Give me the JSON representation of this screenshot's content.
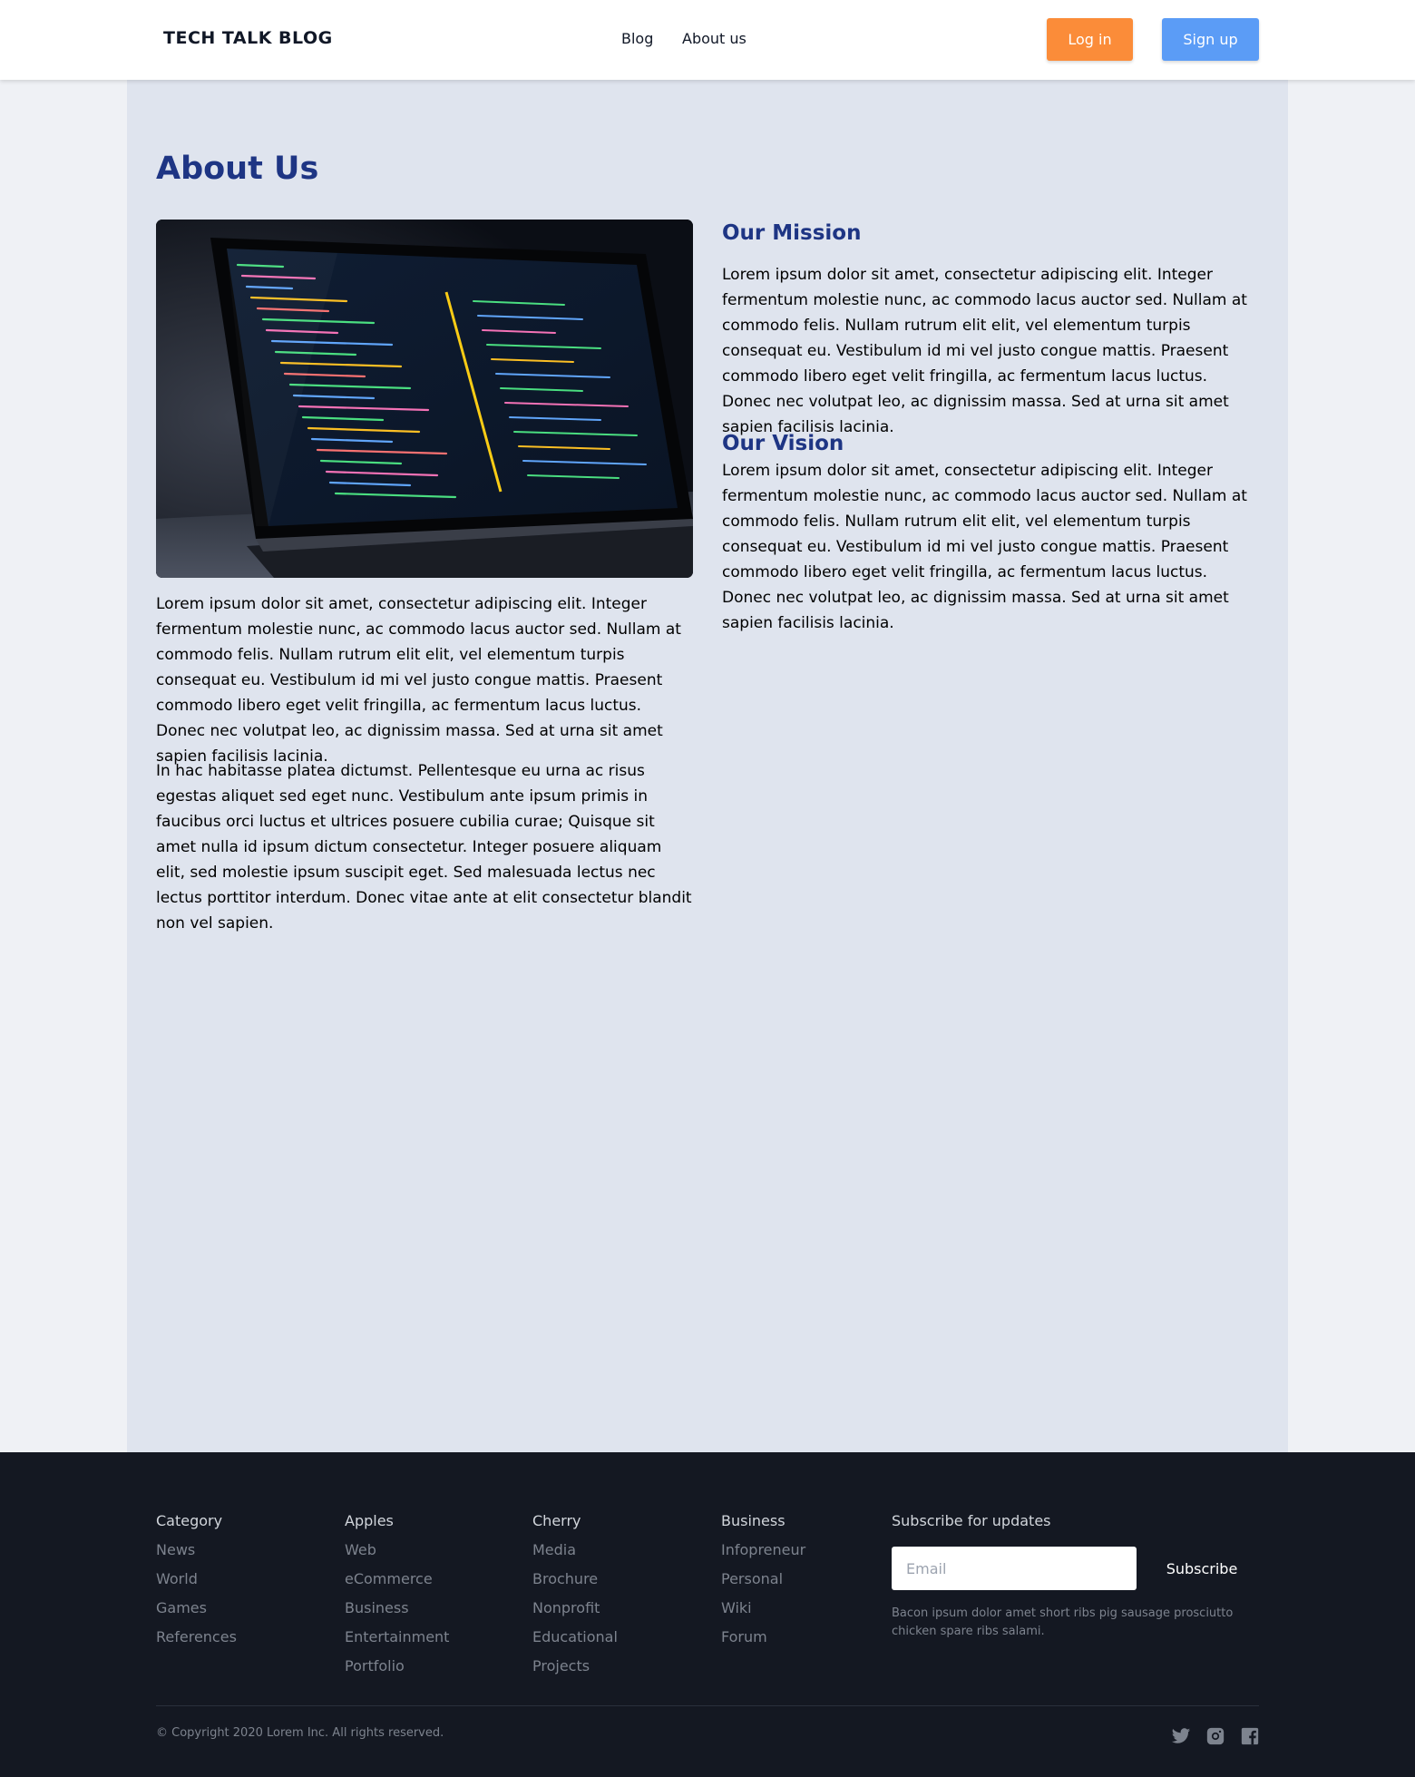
{
  "header": {
    "brand": "TECH TALK BLOG",
    "nav": {
      "blog": "Blog",
      "about": "About us"
    },
    "login_label": "Log in",
    "signup_label": "Sign up",
    "colors": {
      "login": "#fb8c39",
      "signup": "#5b9cf6"
    }
  },
  "main": {
    "title": "About Us",
    "image_icon": "laptop-code-photo",
    "left_paragraphs": [
      "Lorem ipsum dolor sit amet, consectetur adipiscing elit. Integer fermentum molestie nunc, ac commodo lacus auctor sed. Nullam at commodo felis. Nullam rutrum elit elit, vel elementum turpis consequat eu. Vestibulum id mi vel justo congue mattis. Praesent commodo libero eget velit fringilla, ac fermentum lacus luctus. Donec nec volutpat leo, ac dignissim massa. Sed at urna sit amet sapien facilisis lacinia.",
      "In hac habitasse platea dictumst. Pellentesque eu urna ac risus egestas aliquet sed eget nunc. Vestibulum ante ipsum primis in faucibus orci luctus et ultrices posuere cubilia curae; Quisque sit amet nulla id ipsum dictum consectetur. Integer posuere aliquam elit, sed molestie ipsum suscipit eget. Sed malesuada lectus nec lectus porttitor interdum. Donec vitae ante at elit consectetur blandit non vel sapien."
    ],
    "mission": {
      "title": "Our Mission",
      "text": "Lorem ipsum dolor sit amet, consectetur adipiscing elit. Integer fermentum molestie nunc, ac commodo lacus auctor sed. Nullam at commodo felis. Nullam rutrum elit elit, vel elementum turpis consequat eu. Vestibulum id mi vel justo congue mattis. Praesent commodo libero eget velit fringilla, ac fermentum lacus luctus. Donec nec volutpat leo, ac dignissim massa. Sed at urna sit amet sapien facilisis lacinia."
    },
    "vision": {
      "title": "Our Vision",
      "text": "Lorem ipsum dolor sit amet, consectetur adipiscing elit. Integer fermentum molestie nunc, ac commodo lacus auctor sed. Nullam at commodo felis. Nullam rutrum elit elit, vel elementum turpis consequat eu. Vestibulum id mi vel justo congue mattis. Praesent commodo libero eget velit fringilla, ac fermentum lacus luctus. Donec nec volutpat leo, ac dignissim massa. Sed at urna sit amet sapien facilisis lacinia."
    },
    "colors": {
      "heading": "#1e3584",
      "panel": "#dfe4ee"
    }
  },
  "footer": {
    "columns": [
      {
        "title": "Category",
        "links": [
          "News",
          "World",
          "Games",
          "References"
        ]
      },
      {
        "title": "Apples",
        "links": [
          "Web",
          "eCommerce",
          "Business",
          "Entertainment",
          "Portfolio"
        ]
      },
      {
        "title": "Cherry",
        "links": [
          "Media",
          "Brochure",
          "Nonprofit",
          "Educational",
          "Projects"
        ]
      },
      {
        "title": "Business",
        "links": [
          "Infopreneur",
          "Personal",
          "Wiki",
          "Forum"
        ]
      }
    ],
    "subscribe": {
      "title": "Subscribe for updates",
      "email_placeholder": "Email",
      "button_label": "Subscribe",
      "note": "Bacon ipsum dolor amet short ribs pig sausage prosciutto chicken spare ribs salami."
    },
    "copyright": "© Copyright 2020 Lorem Inc. All rights reserved.",
    "social_icons": [
      "twitter-icon",
      "instagram-icon",
      "facebook-icon"
    ],
    "colors": {
      "background": "#141822",
      "link": "#7d838e"
    }
  }
}
